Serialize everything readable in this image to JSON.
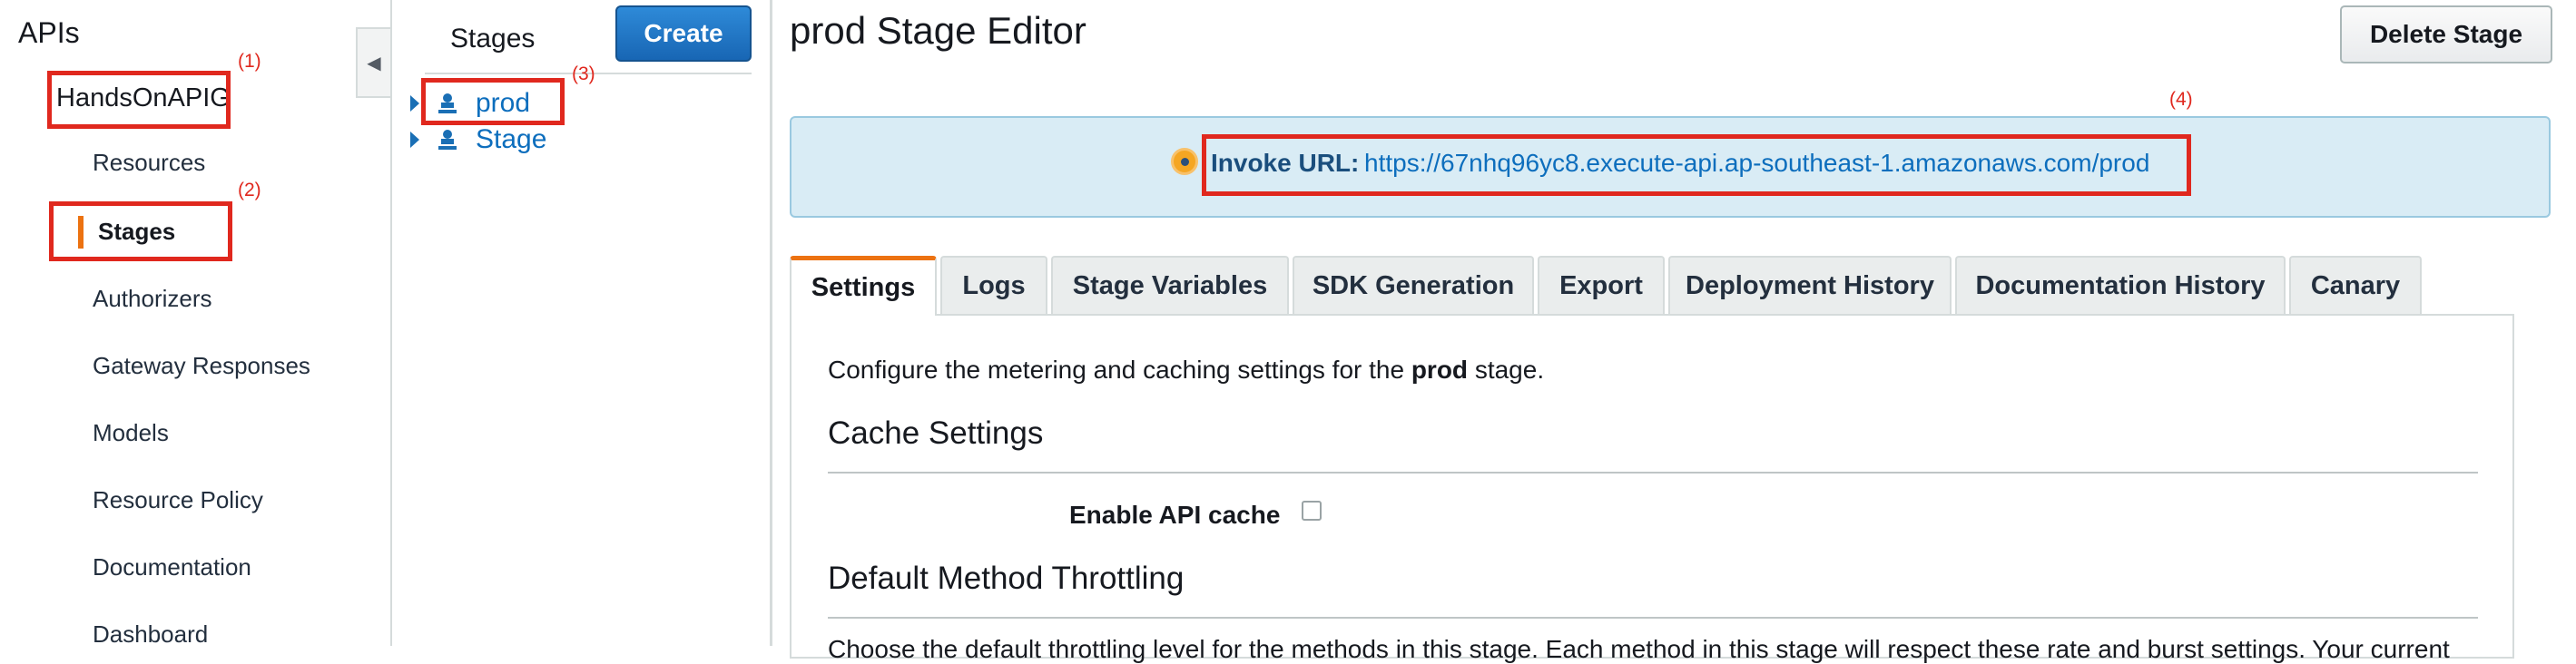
{
  "nav": {
    "title": "APIs",
    "api_name": "HandsOnAPIG",
    "items": [
      "Resources",
      "Stages",
      "Authorizers",
      "Gateway Responses",
      "Models",
      "Resource Policy",
      "Documentation",
      "Dashboard"
    ]
  },
  "callouts": [
    "(1)",
    "(2)",
    "(3)",
    "(4)"
  ],
  "stages_panel": {
    "title": "Stages",
    "create_label": "Create",
    "tree": [
      "prod",
      "Stage"
    ]
  },
  "editor": {
    "title": "prod Stage Editor",
    "delete_label": "Delete Stage",
    "invoke_label": "Invoke URL:",
    "invoke_url": "https://67nhq96yc8.execute-api.ap-southeast-1.amazonaws.com/prod",
    "tabs": [
      "Settings",
      "Logs",
      "Stage Variables",
      "SDK Generation",
      "Export",
      "Deployment History",
      "Documentation History",
      "Canary"
    ],
    "description_prefix": "Configure the metering and caching settings for the ",
    "description_stage": "prod",
    "description_suffix": " stage.",
    "cache_heading": "Cache Settings",
    "cache_label": "Enable API cache",
    "throttle_heading": "Default Method Throttling",
    "throttle_text": "Choose the default throttling level for the methods in this stage. Each method in this stage will respect these rate and burst settings. Your current"
  },
  "colors": {
    "accent": "#ec7211",
    "link": "#0d6ebd",
    "callout": "#e0281e",
    "invoke_bg": "#d9ecf5"
  }
}
